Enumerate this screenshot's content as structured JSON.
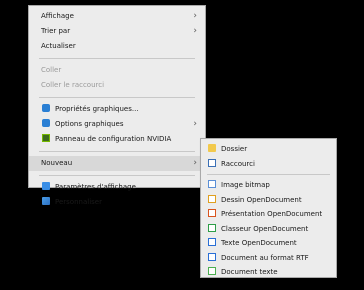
{
  "context_menu": {
    "items": [
      {
        "label": "Affichage"
      },
      {
        "label": "Trier par"
      },
      {
        "label": "Actualiser"
      },
      {
        "label": "Coller"
      },
      {
        "label": "Coller le raccourci"
      },
      {
        "label": "Propriétés graphiques..."
      },
      {
        "label": "Options graphiques"
      },
      {
        "label": "Panneau de configuration NVIDIA"
      },
      {
        "label": "Nouveau"
      },
      {
        "label": "Paramètres d'affichage"
      },
      {
        "label": "Personnaliser"
      }
    ]
  },
  "submenu": {
    "items": [
      {
        "label": "Dossier"
      },
      {
        "label": "Raccourci"
      },
      {
        "label": "Image bitmap"
      },
      {
        "label": "Dessin OpenDocument"
      },
      {
        "label": "Présentation OpenDocument"
      },
      {
        "label": "Classeur OpenDocument"
      },
      {
        "label": "Texte OpenDocument"
      },
      {
        "label": "Document au format RTF"
      },
      {
        "label": "Document texte"
      }
    ]
  },
  "icons": {
    "graphics_properties": "intel-graphics-icon",
    "graphics_options": "intel-graphics-icon",
    "nvidia": "nvidia-icon",
    "display_settings": "display-icon",
    "personalize": "personalize-icon",
    "folder": "folder-icon",
    "shortcut": "shortcut-icon",
    "bitmap": "bitmap-icon",
    "drawing": "drawing-icon",
    "presentation": "presentation-icon",
    "spreadsheet": "spreadsheet-icon",
    "text_document": "writer-icon",
    "rtf": "writer-icon",
    "plain_text": "text-file-icon"
  },
  "colors": {
    "menu_bg": "#ececec",
    "highlight": "#d8d8d8",
    "disabled_text": "#9a9a9a"
  }
}
